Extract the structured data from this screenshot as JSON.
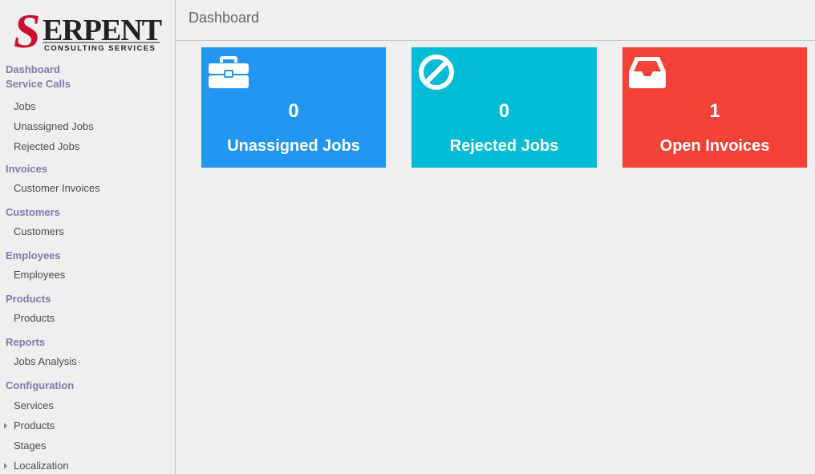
{
  "brand": {
    "logo_main": "SERPENT",
    "logo_sub": "CONSULTING SERVICES"
  },
  "sidebar": {
    "dashboard": "Dashboard",
    "service_calls": {
      "label": "Service Calls",
      "items": [
        "Jobs",
        "Unassigned Jobs",
        "Rejected Jobs"
      ]
    },
    "invoices": {
      "label": "Invoices",
      "items": [
        "Customer Invoices"
      ]
    },
    "customers": {
      "label": "Customers",
      "items": [
        "Customers"
      ]
    },
    "employees": {
      "label": "Employees",
      "items": [
        "Employees"
      ]
    },
    "products": {
      "label": "Products",
      "items": [
        "Products"
      ]
    },
    "reports": {
      "label": "Reports",
      "items": [
        "Jobs Analysis"
      ]
    },
    "configuration": {
      "label": "Configuration",
      "items": [
        "Services",
        "Products",
        "Stages",
        "Localization"
      ]
    }
  },
  "header": {
    "title": "Dashboard"
  },
  "tiles": [
    {
      "label": "Unassigned Jobs",
      "value": "0",
      "color": "#2196f3",
      "icon": "briefcase-icon"
    },
    {
      "label": "Rejected Jobs",
      "value": "0",
      "color": "#00bcd4",
      "icon": "ban-icon"
    },
    {
      "label": "Open Invoices",
      "value": "1",
      "color": "#f44336",
      "icon": "inbox-icon"
    }
  ],
  "colors": {
    "background": "#f0eeee",
    "section_header": "#7c7bad",
    "menu_text": "#4c4c4c",
    "logo_red": "#c8102e"
  }
}
